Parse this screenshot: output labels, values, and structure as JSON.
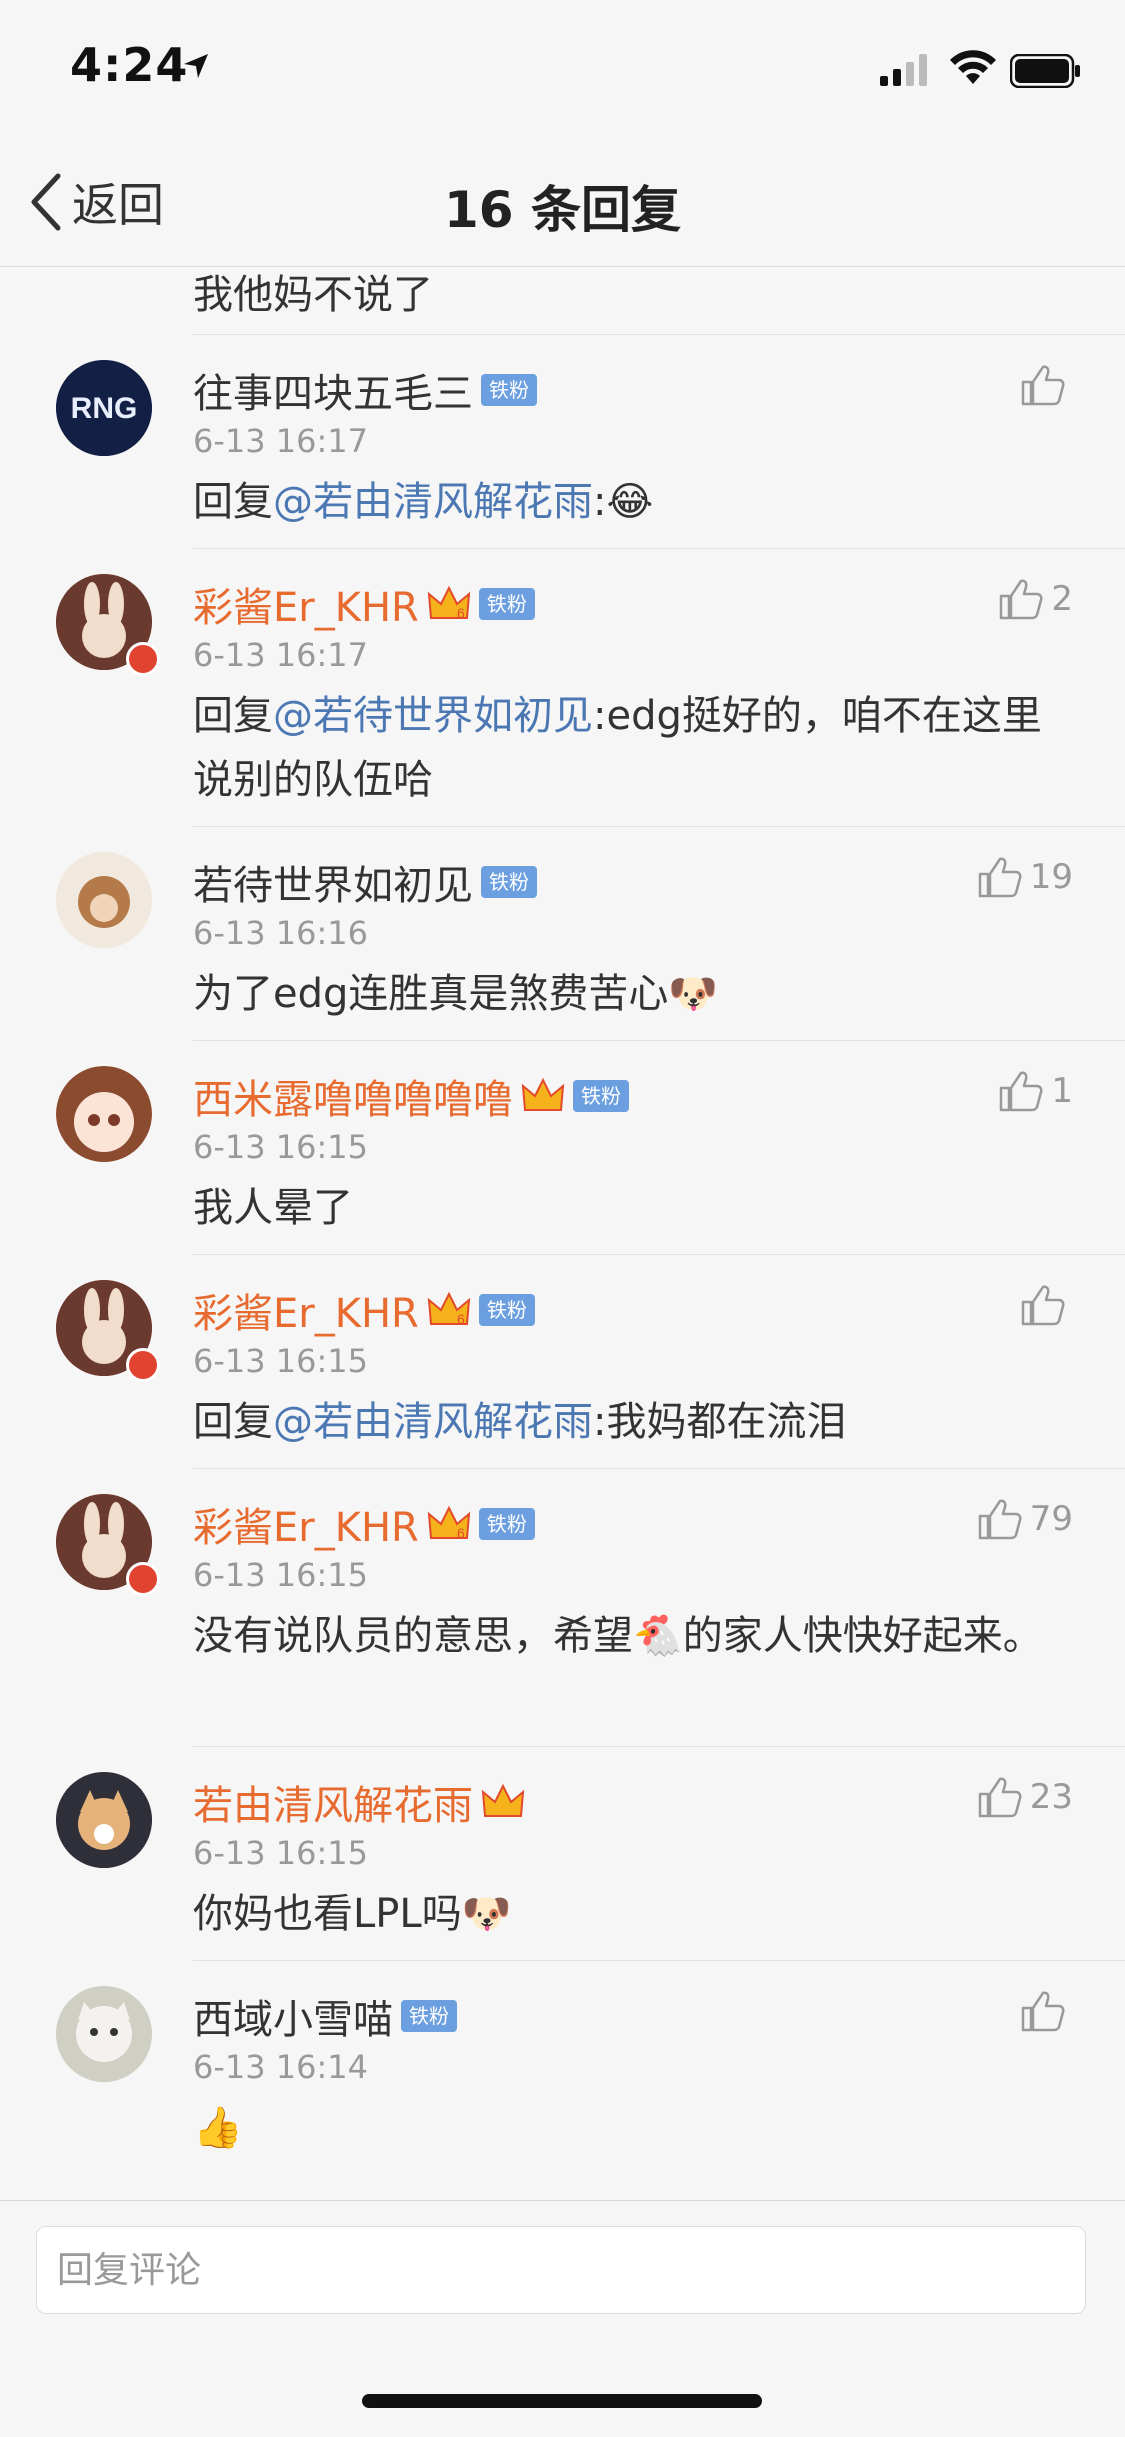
{
  "status": {
    "time": "4:24"
  },
  "nav": {
    "back_label": "返回",
    "title": "16 条回复"
  },
  "partial_text": "我他妈不说了",
  "comments": [
    {
      "name": "往事四块五毛三",
      "vip": false,
      "crown": false,
      "fan": "铁粉",
      "time": "6-13 16:17",
      "prefix": "回复",
      "mention": "@若由清风解花雨",
      "text": ":😂",
      "likes": ""
    },
    {
      "name": "彩酱Er_KHR",
      "vip": true,
      "crown": true,
      "fan": "铁粉",
      "time": "6-13 16:17",
      "prefix": "回复",
      "mention": "@若待世界如初见",
      "text": ":edg挺好的，咱不在这里说别的队伍哈",
      "likes": "2"
    },
    {
      "name": "若待世界如初见",
      "vip": false,
      "crown": false,
      "fan": "铁粉",
      "time": "6-13 16:16",
      "prefix": "",
      "mention": "",
      "text": "为了edg连胜真是煞费苦心🐶",
      "likes": "19"
    },
    {
      "name": "西米露噜噜噜噜噜",
      "vip": true,
      "crown": true,
      "fan": "铁粉",
      "time": "6-13 16:15",
      "prefix": "",
      "mention": "",
      "text": "我人晕了",
      "likes": "1"
    },
    {
      "name": "彩酱Er_KHR",
      "vip": true,
      "crown": true,
      "fan": "铁粉",
      "time": "6-13 16:15",
      "prefix": "回复",
      "mention": "@若由清风解花雨",
      "text": ":我妈都在流泪",
      "likes": ""
    },
    {
      "name": "彩酱Er_KHR",
      "vip": true,
      "crown": true,
      "fan": "铁粉",
      "time": "6-13 16:15",
      "prefix": "",
      "mention": "",
      "text": "没有说队员的意思，希望🐔的家人快快好起来。",
      "likes": "79"
    },
    {
      "name": "若由清风解花雨",
      "vip": true,
      "crown": true,
      "fan": "",
      "time": "6-13 16:15",
      "prefix": "",
      "mention": "",
      "text": "你妈也看LPL吗🐶",
      "likes": "23"
    },
    {
      "name": "西域小雪喵",
      "vip": false,
      "crown": false,
      "fan": "铁粉",
      "time": "6-13 16:14",
      "prefix": "",
      "mention": "",
      "text": "👍",
      "likes": ""
    }
  ],
  "input": {
    "placeholder": "回复评论"
  },
  "colors": {
    "vip_name": "#e76a2f",
    "mention": "#4b77b3",
    "fan_badge": "#6b9fe0"
  }
}
